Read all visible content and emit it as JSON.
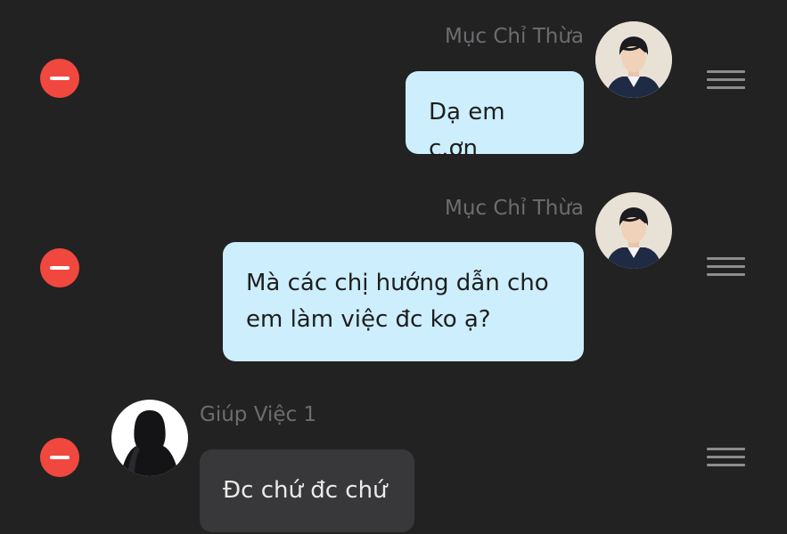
{
  "messages": [
    {
      "sender": "Mục Chỉ Thừa",
      "text": "Dạ em c.ơn",
      "direction": "outgoing",
      "avatar_icon": "user-photo-avatar"
    },
    {
      "sender": "Mục Chỉ Thừa",
      "text": "Mà các chị hướng dẫn cho em làm việc đc ko ạ?",
      "direction": "outgoing",
      "avatar_icon": "user-photo-avatar"
    },
    {
      "sender": "Giúp Việc 1",
      "text": "Đc chứ đc chứ",
      "direction": "incoming",
      "avatar_icon": "silhouette-avatar"
    }
  ],
  "icons": {
    "delete": "minus-circle-icon",
    "reorder": "drag-handle-icon"
  },
  "colors": {
    "background": "#222223",
    "delete_red": "#f0483e",
    "outgoing_bubble": "#cdeefd",
    "incoming_bubble": "#38383a",
    "sender_name": "#6d6d70",
    "handle": "#8d8d90"
  }
}
